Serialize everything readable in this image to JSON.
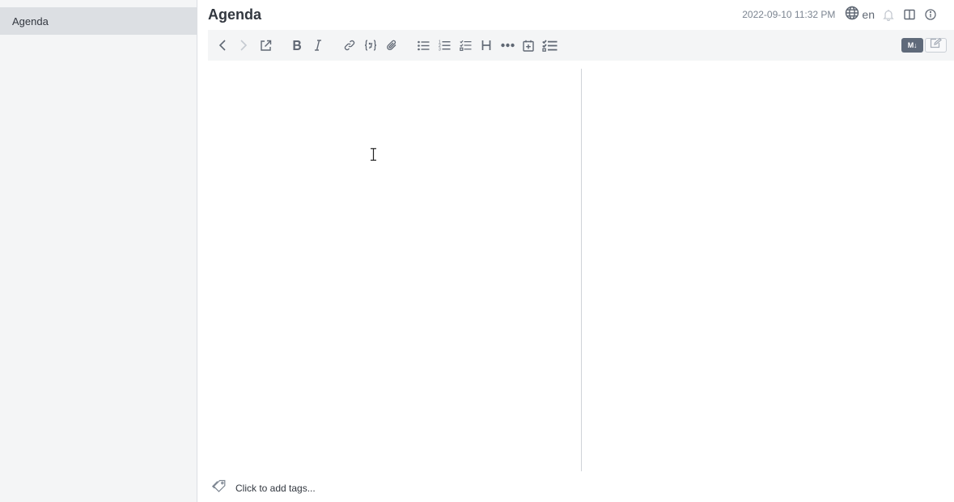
{
  "sidebar": {
    "notes": [
      {
        "title": "Agenda",
        "selected": true
      }
    ]
  },
  "note": {
    "title": "Agenda",
    "updated": "2022-09-10 11:32 PM",
    "language": "en",
    "body": ""
  },
  "header_icons": [
    "globe-icon",
    "alarm-bell-icon",
    "split-layout-icon",
    "info-icon"
  ],
  "toolbar": {
    "buttons": [
      "back-icon",
      "forward-icon",
      "external-open-icon",
      "bold-icon",
      "italic-icon",
      "link-icon",
      "code-icon",
      "attachment-icon",
      "bullet-list-icon",
      "numbered-list-icon",
      "checkbox-list-icon",
      "heading-icon",
      "horizontal-rule-icon",
      "insert-date-icon",
      "toc-icon"
    ],
    "markdown_toggle_label": "M↓"
  },
  "tags": {
    "placeholder": "Click to add tags..."
  },
  "colors": {
    "sidebar_bg": "#f4f5f6",
    "selected_item": "#dcdfe3",
    "icon": "#606874",
    "disabled_icon": "#c5cad1",
    "text": "#32373f",
    "muted_text": "#7c8591"
  }
}
